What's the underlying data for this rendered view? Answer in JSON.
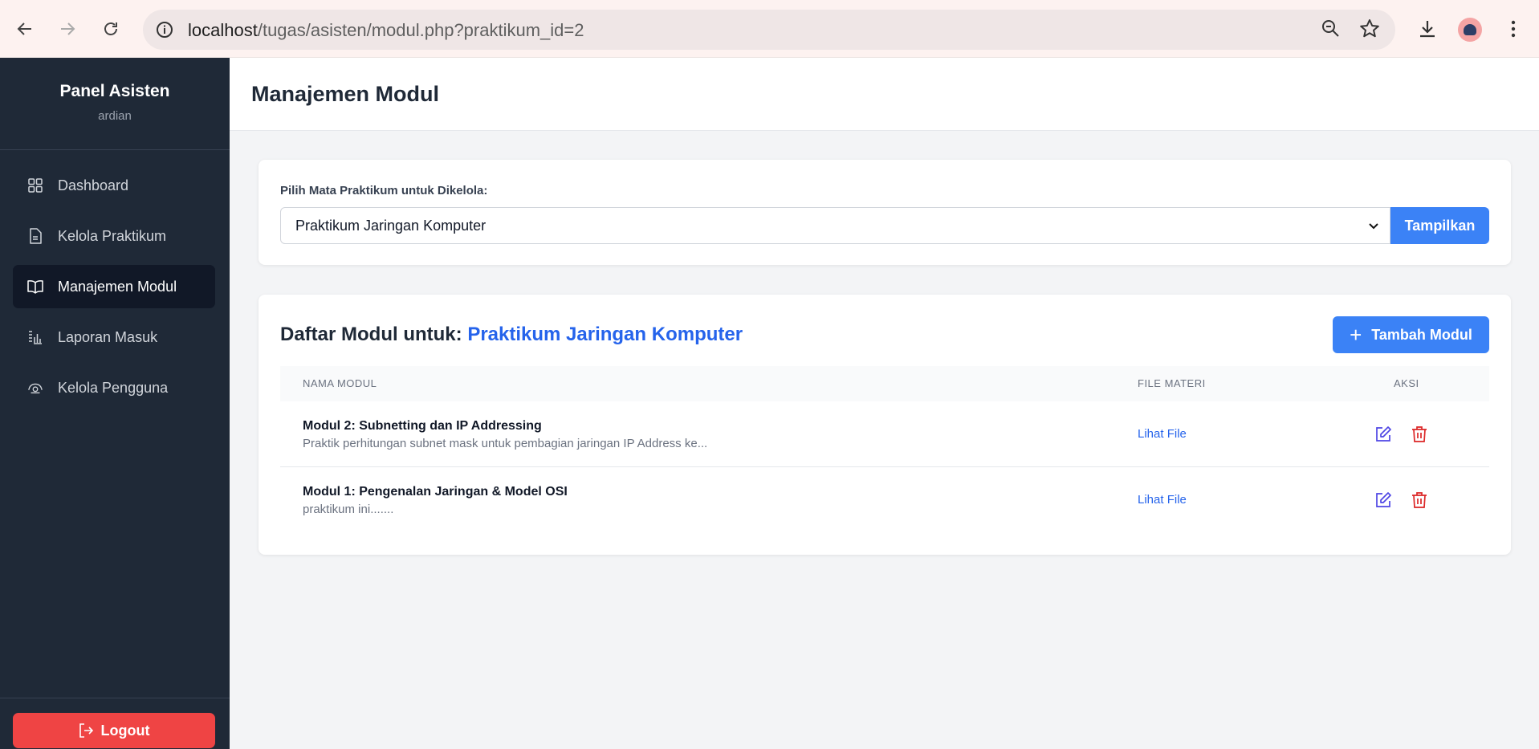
{
  "browser": {
    "url_host": "localhost",
    "url_path": "/tugas/asisten/modul.php?praktikum_id=2"
  },
  "sidebar": {
    "title": "Panel Asisten",
    "username": "ardian",
    "items": [
      {
        "label": "Dashboard",
        "icon": "grid-icon"
      },
      {
        "label": "Kelola Praktikum",
        "icon": "document-icon"
      },
      {
        "label": "Manajemen Modul",
        "icon": "book-open-icon",
        "active": true
      },
      {
        "label": "Laporan Masuk",
        "icon": "report-list-icon"
      },
      {
        "label": "Kelola Pengguna",
        "icon": "users-icon"
      }
    ],
    "logout_label": "Logout"
  },
  "header": {
    "title": "Manajemen Modul"
  },
  "selector": {
    "label": "Pilih Mata Praktikum untuk Dikelola:",
    "selected": "Praktikum Jaringan Komputer",
    "button_label": "Tampilkan"
  },
  "module_list": {
    "title_prefix": "Daftar Modul untuk:",
    "praktikum_name": "Praktikum Jaringan Komputer",
    "add_button_label": "Tambah Modul",
    "columns": [
      "NAMA MODUL",
      "FILE MATERI",
      "AKSI"
    ],
    "rows": [
      {
        "title": "Modul 2: Subnetting dan IP Addressing",
        "description": "Praktik perhitungan subnet mask untuk pembagian jaringan IP Address ke...",
        "file_link": "Lihat File"
      },
      {
        "title": "Modul 1: Pengenalan Jaringan & Model OSI",
        "description": "praktikum ini.......",
        "file_link": "Lihat File"
      }
    ]
  },
  "colors": {
    "sidebar_bg": "#1f2937",
    "primary": "#3b82f6",
    "danger": "#ef4444",
    "link": "#2563eb",
    "edit_icon": "#4f46e5",
    "delete_icon": "#dc2626"
  }
}
